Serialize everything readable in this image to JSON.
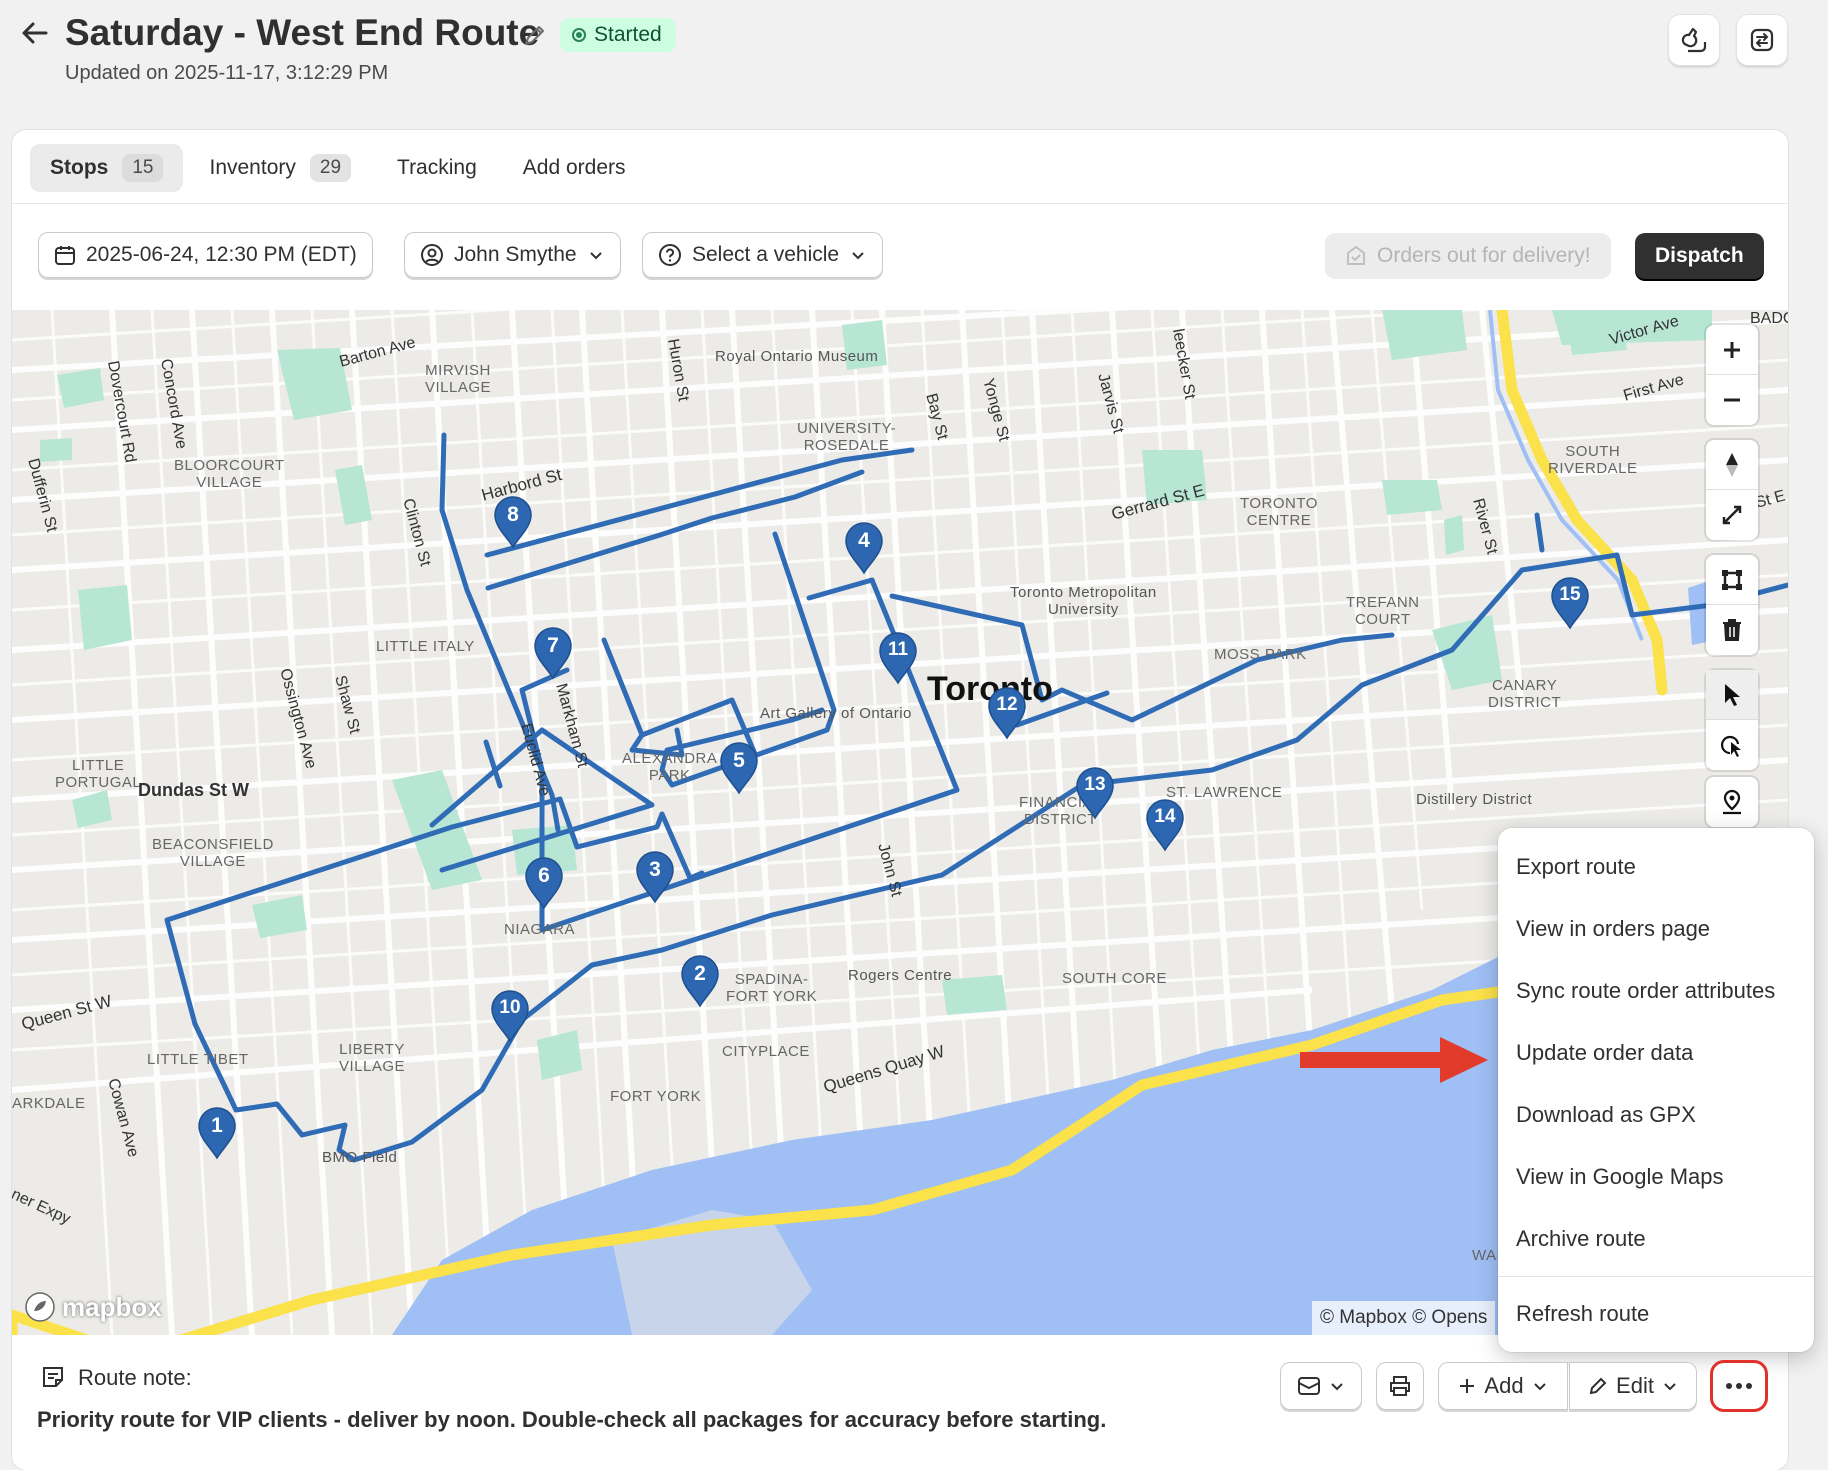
{
  "header": {
    "title": "Saturday - West End Route",
    "status": "Started",
    "updated": "Updated on 2025-11-17, 3:12:29 PM"
  },
  "tabs": [
    {
      "label": "Stops",
      "count": "15"
    },
    {
      "label": "Inventory",
      "count": "29"
    },
    {
      "label": "Tracking",
      "count": ""
    },
    {
      "label": "Add orders",
      "count": ""
    }
  ],
  "filters": {
    "date": "2025-06-24, 12:30 PM (EDT)",
    "driver": "John Smythe",
    "vehicle": "Select a vehicle",
    "orders_out": "Orders out for delivery!",
    "dispatch": "Dispatch"
  },
  "map": {
    "city": "Toronto",
    "neighbourhoods": [
      "MIRVISH",
      "VILLAGE",
      "BLOORCOURT",
      "VILLAGE",
      "UNIVERSITY-",
      "ROSEDALE",
      "TORONTO",
      "CENTRE",
      "SOUTH",
      "RIVERDALE",
      "TREFANN",
      "COURT",
      "MOSS PARK",
      "CANARY",
      "DISTRICT",
      "LITTLE ITALY",
      "LITTLE",
      "PORTUGAL",
      "ALEXANDRA",
      "PARK",
      "FINANCIAL",
      "DISTRICT",
      "ST. LAWRENCE",
      "BEACONSFIELD",
      "VILLAGE",
      "NIAGARA",
      "SPADINA-",
      "FORT YORK",
      "SOUTH CORE",
      "LIBERTY",
      "VILLAGE",
      "LITTLE TIBET",
      "CITYPLACE",
      "FORT YORK",
      "ARKDALE",
      "WARD'"
    ],
    "pois": [
      "Royal Ontario Museum",
      "Toronto Metropolitan",
      "University",
      "Art Gallery of Ontario",
      "Rogers Centre",
      "Distillery District",
      "BMO Field"
    ],
    "streets": [
      "Dovercourt Rd",
      "Concord Ave",
      "Barton Ave",
      "Huron St",
      "Bay St",
      "Yonge St",
      "Jarvis St",
      "leecker St",
      "Victor Ave",
      "First Ave",
      "Dufferin St",
      "Harbord St",
      "Clinton St",
      "Gerrard St E",
      "River St",
      "Ossington Ave",
      "Shaw St",
      "Markham St",
      "Euclid Ave",
      "Dundas St W",
      "John St",
      "Queen St W",
      "Cowan Ave",
      "Queens Quay W",
      "ner Expy",
      "St E",
      "BADG"
    ],
    "stops": [
      "1",
      "2",
      "3",
      "4",
      "5",
      "6",
      "7",
      "8",
      "10",
      "11",
      "12",
      "13",
      "14",
      "15"
    ],
    "logo": "mapbox",
    "attribution": "© Mapbox © Opens"
  },
  "menu": {
    "items": [
      "Export route",
      "View in orders page",
      "Sync route order attributes",
      "Update order data",
      "Download as GPX",
      "View in Google Maps",
      "Archive route"
    ],
    "footer_item": "Refresh route"
  },
  "footer": {
    "note_label": "Route note:",
    "note_text": "Priority route for VIP clients - deliver by noon. Double-check all packages for accuracy before starting.",
    "add": "Add",
    "edit": "Edit"
  },
  "colors": {
    "route": "#2f6cb5",
    "marker": "#2d66b1",
    "highway": "#fbe14a",
    "water": "#9fbff5",
    "park": "#b7e6d5",
    "highlight": "#e0312b"
  }
}
